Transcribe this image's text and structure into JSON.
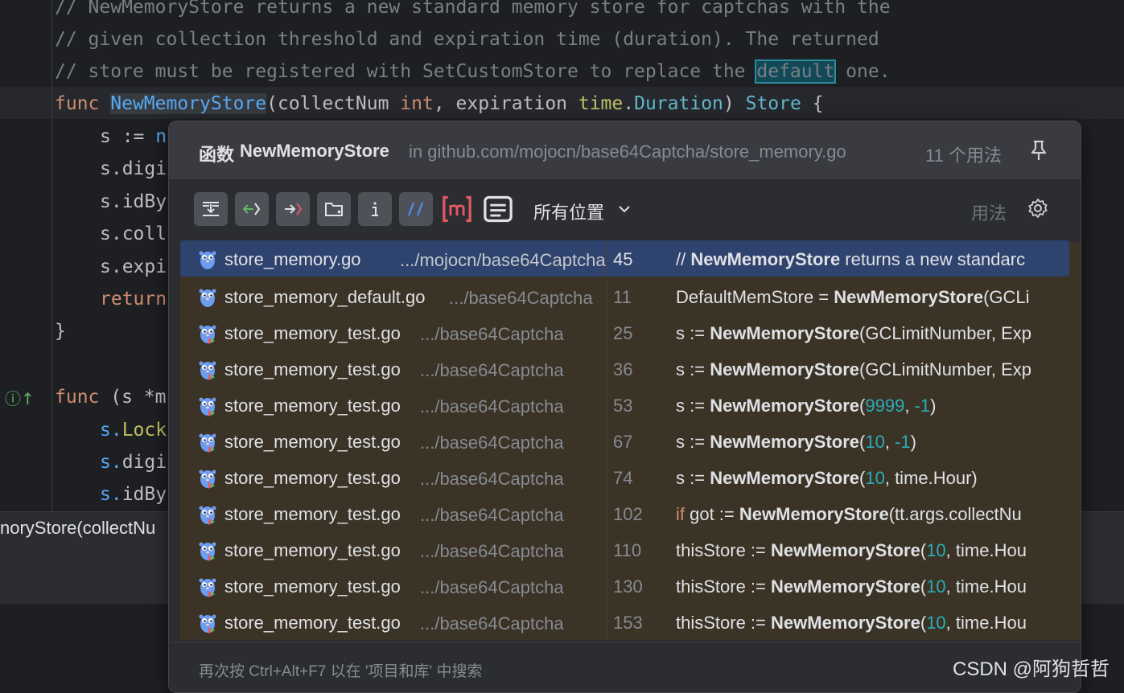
{
  "editor": {
    "line1": {
      "comment": "// NewMemoryStore returns a new standard memory store for captchas with the"
    },
    "line2": {
      "comment": "// given collection threshold and expiration time (duration). The returned"
    },
    "line3": {
      "comment_a": "// store must be registered with SetCustomStore to replace the ",
      "highlight": "default",
      "comment_b": " one."
    },
    "line4": {
      "kw": "func",
      "fn": "NewMemoryStore",
      "p1": "(collectNum ",
      "t1": "int",
      "p2": ", expiration ",
      "pkg": "time",
      "dot": ".",
      "t2": "Duration",
      "p3": ") ",
      "t3": "Store",
      "p4": " {"
    },
    "line5": {
      "a": "s := ",
      "b": "n"
    },
    "line6": "s.digi",
    "line7": "s.idBy",
    "line8": "s.coll",
    "line9": "s.expi",
    "line10": "return",
    "line11": "}",
    "line12": {
      "kw": "func",
      "rest": " (s *m"
    },
    "line13": {
      "a": "s.",
      "b": "Lock"
    },
    "line14": {
      "a": "s.",
      "b": "digi"
    },
    "line15": {
      "a": "s.",
      "b": "idBy"
    },
    "status_text": "noryStore(collectNu"
  },
  "popup": {
    "kind": "函数",
    "name": "NewMemoryStore",
    "in_path": "in github.com/mojocn/base64Captcha/store_memory.go",
    "count": "11 个用法",
    "scope": "所有位置",
    "usages_label": "用法",
    "footer": "再次按 Ctrl+Alt+F7 以在 '项目和库' 中搜索",
    "results": [
      {
        "file": "store_memory.go",
        "path": ".../mojocn/base64Captcha",
        "line": "45",
        "pre": "// ",
        "match": "NewMemoryStore",
        "post": " returns a new standarc",
        "args": []
      },
      {
        "file": "store_memory_default.go",
        "path": ".../base64Captcha",
        "line": "11",
        "pre": "DefaultMemStore = ",
        "match": "NewMemoryStore",
        "post": "(GCLi",
        "args": []
      },
      {
        "file": "store_memory_test.go",
        "path": ".../base64Captcha",
        "line": "25",
        "pre": "s := ",
        "match": "NewMemoryStore",
        "post": "(GCLimitNumber, Exp",
        "args": []
      },
      {
        "file": "store_memory_test.go",
        "path": ".../base64Captcha",
        "line": "36",
        "pre": "s := ",
        "match": "NewMemoryStore",
        "post": "(GCLimitNumber, Exp",
        "args": []
      },
      {
        "file": "store_memory_test.go",
        "path": ".../base64Captcha",
        "line": "53",
        "pre": "s := ",
        "match": "NewMemoryStore",
        "post": "(",
        "n1": "9999",
        "mid": ", ",
        "n2": "-1",
        "end": ")"
      },
      {
        "file": "store_memory_test.go",
        "path": ".../base64Captcha",
        "line": "67",
        "pre": "s := ",
        "match": "NewMemoryStore",
        "post": "(",
        "n1": "10",
        "mid": ", ",
        "n2": "-1",
        "end": ")"
      },
      {
        "file": "store_memory_test.go",
        "path": ".../base64Captcha",
        "line": "74",
        "pre": "s := ",
        "match": "NewMemoryStore",
        "post": "(",
        "n1": "10",
        "mid": ", time.Hour)",
        "n2": "",
        "end": ""
      },
      {
        "file": "store_memory_test.go",
        "path": ".../base64Captcha",
        "line": "102",
        "kw": "if",
        "pre": " got := ",
        "match": "NewMemoryStore",
        "post": "(tt.args.collectNu"
      },
      {
        "file": "store_memory_test.go",
        "path": ".../base64Captcha",
        "line": "110",
        "pre": "thisStore := ",
        "match": "NewMemoryStore",
        "post": "(",
        "n1": "10",
        "mid": ", time.Hou",
        "n2": "",
        "end": ""
      },
      {
        "file": "store_memory_test.go",
        "path": ".../base64Captcha",
        "line": "130",
        "pre": "thisStore := ",
        "match": "NewMemoryStore",
        "post": "(",
        "n1": "10",
        "mid": ", time.Hou",
        "n2": "",
        "end": ""
      },
      {
        "file": "store_memory_test.go",
        "path": ".../base64Captcha",
        "line": "153",
        "pre": "thisStore := ",
        "match": "NewMemoryStore",
        "post": "(",
        "n1": "10",
        "mid": ", time.Hou",
        "n2": "",
        "end": ""
      }
    ],
    "toolbar_icons": [
      "merge-usages-icon",
      "read-access-icon",
      "write-access-icon",
      "directory-filter-icon",
      "info-icon",
      "comments-filter-icon",
      "method-icon",
      "preview-icon"
    ]
  },
  "watermark": "CSDN @阿狗哲哲",
  "colors": {
    "selected_row": "#2e436e",
    "results_bg": "#3b3326",
    "number": "#2aacb8",
    "keyword": "#cf8e6d"
  }
}
